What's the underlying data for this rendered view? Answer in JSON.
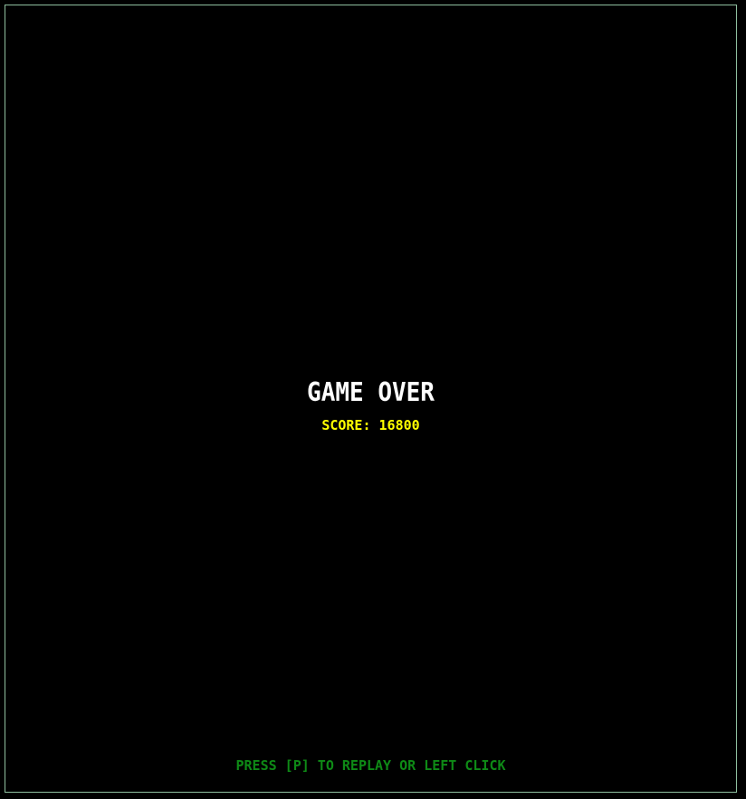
{
  "game_over": {
    "title": "GAME OVER",
    "score_text": "SCORE: 16800",
    "replay_hint": "PRESS [P] TO REPLAY OR LEFT CLICK"
  },
  "colors": {
    "background": "#000000",
    "frame_border": "#8fbf9f",
    "title": "#ffffff",
    "score": "#ffff00",
    "hint": "#0e8a16"
  }
}
